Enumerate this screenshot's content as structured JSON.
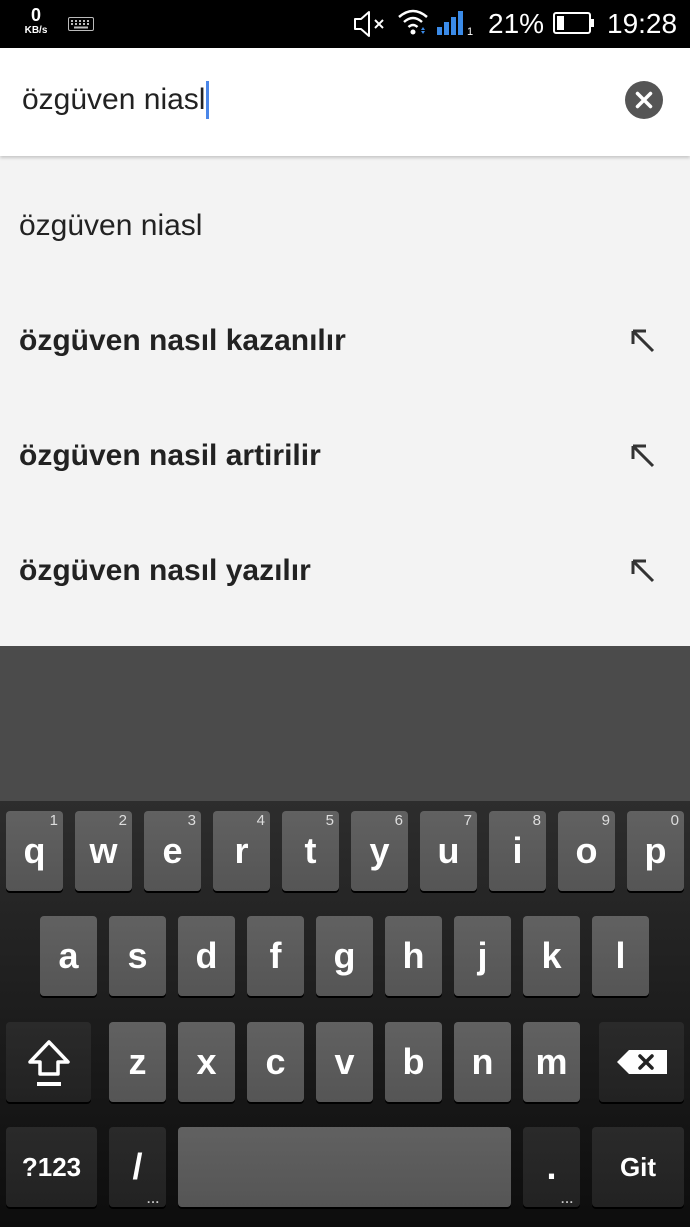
{
  "status_bar": {
    "data_rate": "0",
    "data_rate_unit": "KB/s",
    "keyboard_icon": "keyboard-icon",
    "mute_icon": "volume-mute-icon",
    "wifi_icon": "wifi-icon",
    "signal_icon": "signal-icon",
    "signal_sim": "1",
    "battery_percent": "21%",
    "battery_icon": "battery-icon",
    "time": "19:28"
  },
  "search": {
    "query": "özgüven niasl",
    "clear_icon": "clear-icon"
  },
  "suggestions": [
    {
      "text": "özgüven niasl",
      "bold": false,
      "has_arrow": false
    },
    {
      "text": "özgüven nasıl kazanılır",
      "bold": true,
      "has_arrow": true
    },
    {
      "text": "özgüven nasil artirilir",
      "bold": true,
      "has_arrow": true
    },
    {
      "text": "özgüven nasıl yazılır",
      "bold": true,
      "has_arrow": true
    }
  ],
  "keyboard": {
    "row1": [
      {
        "label": "q",
        "hint": "1"
      },
      {
        "label": "w",
        "hint": "2"
      },
      {
        "label": "e",
        "hint": "3"
      },
      {
        "label": "r",
        "hint": "4"
      },
      {
        "label": "t",
        "hint": "5"
      },
      {
        "label": "y",
        "hint": "6"
      },
      {
        "label": "u",
        "hint": "7"
      },
      {
        "label": "i",
        "hint": "8"
      },
      {
        "label": "o",
        "hint": "9"
      },
      {
        "label": "p",
        "hint": "0"
      }
    ],
    "row2": [
      {
        "label": "a"
      },
      {
        "label": "s"
      },
      {
        "label": "d"
      },
      {
        "label": "f"
      },
      {
        "label": "g"
      },
      {
        "label": "h"
      },
      {
        "label": "j"
      },
      {
        "label": "k"
      },
      {
        "label": "l"
      }
    ],
    "row3": [
      {
        "label": "z"
      },
      {
        "label": "x"
      },
      {
        "label": "c"
      },
      {
        "label": "v"
      },
      {
        "label": "b"
      },
      {
        "label": "n"
      },
      {
        "label": "m"
      }
    ],
    "shift_icon": "shift-icon",
    "backspace_icon": "backspace-icon",
    "symbols_label": "?123",
    "slash_label": "/",
    "period_label": ".",
    "more_dots": "...",
    "go_label": "Git"
  },
  "colors": {
    "caret": "#4a86e8",
    "suggestion_bg": "#f3f3f3",
    "key_bg": "#5a5a5a"
  }
}
